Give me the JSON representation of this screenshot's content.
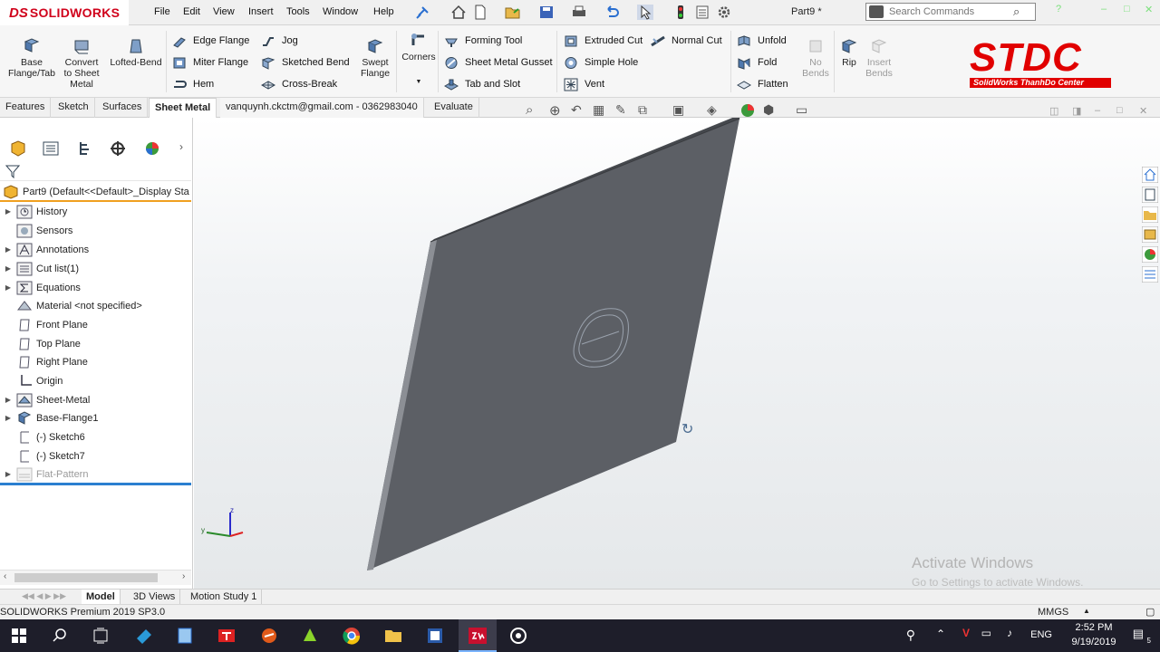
{
  "app": {
    "logo_ds": "DS",
    "logo_name": "SOLIDWORKS",
    "menu": [
      "File",
      "Edit",
      "View",
      "Insert",
      "Tools",
      "Window",
      "Help"
    ],
    "document_title": "Part9 *",
    "search_placeholder": "Search Commands"
  },
  "ribbon": {
    "big_buttons": {
      "base_flange": "Base Flange/Tab",
      "convert": "Convert to Sheet Metal",
      "lofted_bend": "Lofted-Bend",
      "swept_flange": "Swept Flange",
      "corners": "Corners",
      "rip": "Rip",
      "no_bends": "No Bends",
      "insert_bends": "Insert Bends"
    },
    "small_buttons": {
      "edge_flange": "Edge Flange",
      "miter_flange": "Miter Flange",
      "hem": "Hem",
      "jog": "Jog",
      "sketched_bend": "Sketched Bend",
      "cross_break": "Cross-Break",
      "forming_tool": "Forming Tool",
      "sheet_metal_gusset": "Sheet Metal Gusset",
      "tab_and_slot": "Tab and Slot",
      "extruded_cut": "Extruded Cut",
      "simple_hole": "Simple Hole",
      "vent": "Vent",
      "normal_cut": "Normal Cut",
      "unfold": "Unfold",
      "fold": "Fold",
      "flatten": "Flatten"
    },
    "brand": {
      "name": "STDC",
      "tagline": "SolidWorks ThanhDo Center",
      "color": "#e10000"
    }
  },
  "tabs": [
    "Features",
    "Sketch",
    "Surfaces",
    "Sheet Metal",
    "vanquynh.ckctm@gmail.com - 0362983040",
    "Evaluate"
  ],
  "active_tab": "Sheet Metal",
  "tree": {
    "root": "Part9  (Default<<Default>_Display Sta",
    "items": [
      {
        "label": "History",
        "expandable": true
      },
      {
        "label": "Sensors",
        "expandable": false
      },
      {
        "label": "Annotations",
        "expandable": true
      },
      {
        "label": "Cut list(1)",
        "expandable": true
      },
      {
        "label": "Equations",
        "expandable": true
      },
      {
        "label": "Material <not specified>",
        "expandable": false
      },
      {
        "label": "Front Plane",
        "expandable": false
      },
      {
        "label": "Top Plane",
        "expandable": false
      },
      {
        "label": "Right Plane",
        "expandable": false
      },
      {
        "label": "Origin",
        "expandable": false
      },
      {
        "label": "Sheet-Metal",
        "expandable": true
      },
      {
        "label": "Base-Flange1",
        "expandable": true
      },
      {
        "label": "(-) Sketch6",
        "expandable": false
      },
      {
        "label": "(-) Sketch7",
        "expandable": false
      },
      {
        "label": "Flat-Pattern",
        "expandable": true,
        "suppressed": true
      }
    ]
  },
  "viewport": {
    "activate_title": "Activate Windows",
    "activate_sub": "Go to Settings to activate Windows."
  },
  "bottom_tabs": [
    "Model",
    "3D Views",
    "Motion Study 1"
  ],
  "status": {
    "left": "SOLIDWORKS Premium 2019 SP3.0",
    "units": "MMGS"
  },
  "taskbar": {
    "lang": "ENG",
    "time": "2:52 PM",
    "date": "9/19/2019",
    "notifications": "5"
  }
}
